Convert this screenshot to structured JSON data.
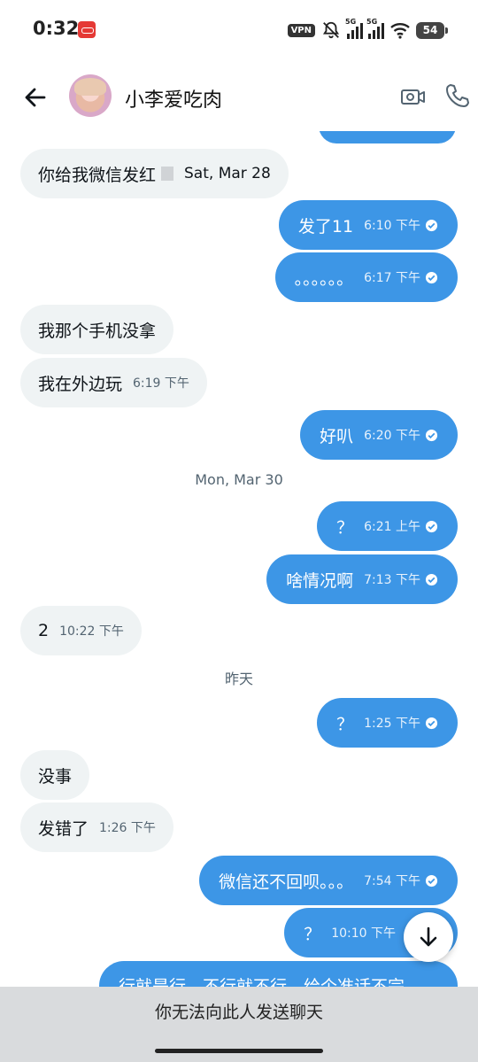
{
  "status_bar": {
    "time": "0:32",
    "vpn_label": "VPN",
    "signal_1_label": "5G",
    "signal_2_label": "5G",
    "battery": "54"
  },
  "header": {
    "contact_name": "小李爱吃肉",
    "icons": [
      "back-arrow-icon",
      "avatar",
      "video-call-icon",
      "phone-icon"
    ]
  },
  "messages": [
    {
      "dir": "in",
      "text": "你给我微信发红",
      "meta": "Sat, Mar 28"
    },
    {
      "dir": "out",
      "text": "发了11",
      "meta": "6:10 下午"
    },
    {
      "dir": "out",
      "text": "。。。。。。",
      "meta": "6:17 下午"
    },
    {
      "dir": "in",
      "text": "我那个手机没拿",
      "meta": ""
    },
    {
      "dir": "in",
      "text": "我在外边玩",
      "meta": "6:19 下午"
    },
    {
      "dir": "out",
      "text": "好叭",
      "meta": "6:20 下午"
    },
    {
      "dir": "out",
      "text": "？",
      "meta": "6:21 上午"
    },
    {
      "dir": "out",
      "text": "啥情况啊",
      "meta": "7:13 下午"
    },
    {
      "dir": "in",
      "text": "2",
      "meta": "10:22 下午"
    },
    {
      "dir": "out",
      "text": "？",
      "meta": "1:25 下午"
    },
    {
      "dir": "in",
      "text": "没事",
      "meta": ""
    },
    {
      "dir": "in",
      "text": "发错了",
      "meta": "1:26 下午"
    },
    {
      "dir": "out",
      "text": "微信还不回呗。。。",
      "meta": "7:54 下午"
    },
    {
      "dir": "out",
      "text": "？",
      "meta": "10:10 下午"
    },
    {
      "dir": "out",
      "text": "行就是行，不行就不行，给个准话不完",
      "meta": ""
    }
  ],
  "date_separators": [
    "Mon, Mar 30",
    "昨天"
  ],
  "footer": {
    "note": "你无法向此人发送聊天"
  },
  "colors": {
    "outgoing_bubble": "#3d96e6",
    "incoming_bubble": "#eff3f4",
    "footer_bg": "#d9dbdd"
  }
}
